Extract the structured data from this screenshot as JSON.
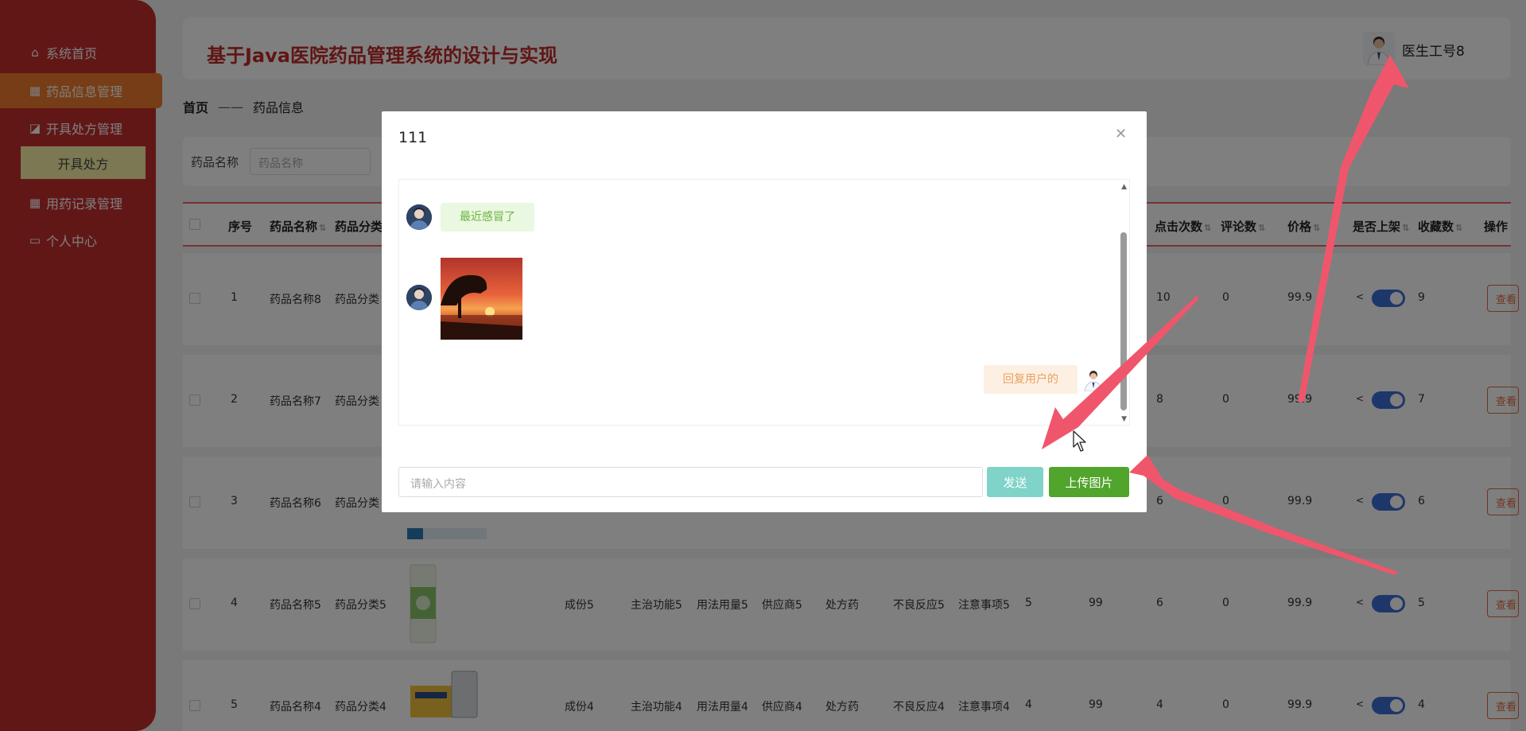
{
  "sidebar": {
    "items": [
      {
        "label": "系统首页",
        "icon": "home-icon"
      },
      {
        "label": "药品信息管理",
        "icon": "grid-icon"
      },
      {
        "label": "开具处方管理",
        "icon": "chart-icon"
      },
      {
        "label": "用药记录管理",
        "icon": "grid-icon"
      },
      {
        "label": "个人中心",
        "icon": "card-icon"
      }
    ],
    "sub_item": "开具处方"
  },
  "header": {
    "title": "基于Java医院药品管理系统的设计与实现",
    "user_name": "医生工号8"
  },
  "breadcrumb": {
    "home": "首页",
    "separator": "——",
    "current": "药品信息"
  },
  "search": {
    "label": "药品名称",
    "placeholder": "药品名称"
  },
  "table": {
    "headers": {
      "index": "序号",
      "name": "药品名称",
      "category": "药品分类",
      "clicks": "点击次数",
      "comments": "评论数",
      "price": "价格",
      "on_shelf": "是否上架",
      "favorites": "收藏数",
      "actions": "操作"
    },
    "view_label": "查看",
    "rows": [
      {
        "index": "1",
        "name": "药品名称8",
        "category": "药品分类",
        "ingredient": "",
        "function": "",
        "usage": "",
        "supplier": "",
        "type": "",
        "side_effects": "",
        "notes": "",
        "col_a": "",
        "col_b": "",
        "clicks": "10",
        "comments": "0",
        "price": "99.9",
        "favorites": "9"
      },
      {
        "index": "2",
        "name": "药品名称7",
        "category": "药品分类",
        "ingredient": "",
        "function": "",
        "usage": "",
        "supplier": "",
        "type": "",
        "side_effects": "",
        "notes": "",
        "col_a": "",
        "col_b": "",
        "clicks": "8",
        "comments": "0",
        "price": "99.9",
        "favorites": "7"
      },
      {
        "index": "3",
        "name": "药品名称6",
        "category": "药品分类",
        "ingredient": "",
        "function": "",
        "usage": "",
        "supplier": "",
        "type": "",
        "side_effects": "",
        "notes": "",
        "col_a": "",
        "col_b": "",
        "clicks": "6",
        "comments": "0",
        "price": "99.9",
        "favorites": "6"
      },
      {
        "index": "4",
        "name": "药品名称5",
        "category": "药品分类5",
        "ingredient": "成份5",
        "function": "主治功能5",
        "usage": "用法用量5",
        "supplier": "供应商5",
        "type": "处方药",
        "side_effects": "不良反应5",
        "notes": "注意事项5",
        "col_a": "5",
        "col_b": "99",
        "clicks": "6",
        "comments": "0",
        "price": "99.9",
        "favorites": "5"
      },
      {
        "index": "5",
        "name": "药品名称4",
        "category": "药品分类4",
        "ingredient": "成份4",
        "function": "主治功能4",
        "usage": "用法用量4",
        "supplier": "供应商4",
        "type": "处方药",
        "side_effects": "不良反应4",
        "notes": "注意事项4",
        "col_a": "4",
        "col_b": "99",
        "clicks": "4",
        "comments": "0",
        "price": "99.9",
        "favorites": "4"
      }
    ]
  },
  "modal": {
    "title": "111",
    "messages": [
      {
        "side": "left",
        "type": "text",
        "text": "最近感冒了"
      },
      {
        "side": "left",
        "type": "image",
        "image": "sunset-photo"
      },
      {
        "side": "right",
        "type": "text",
        "text": "回复用户的"
      }
    ],
    "input_placeholder": "请输入内容",
    "send_label": "发送",
    "upload_label": "上传图片"
  },
  "colors": {
    "sidebar": "#c52f2f",
    "sidebar_active": "#ee7a2c",
    "title": "#c12b2b",
    "send_button": "#7fd3c8",
    "upload_button": "#52a52c",
    "annotation_arrow": "#f0566b"
  }
}
